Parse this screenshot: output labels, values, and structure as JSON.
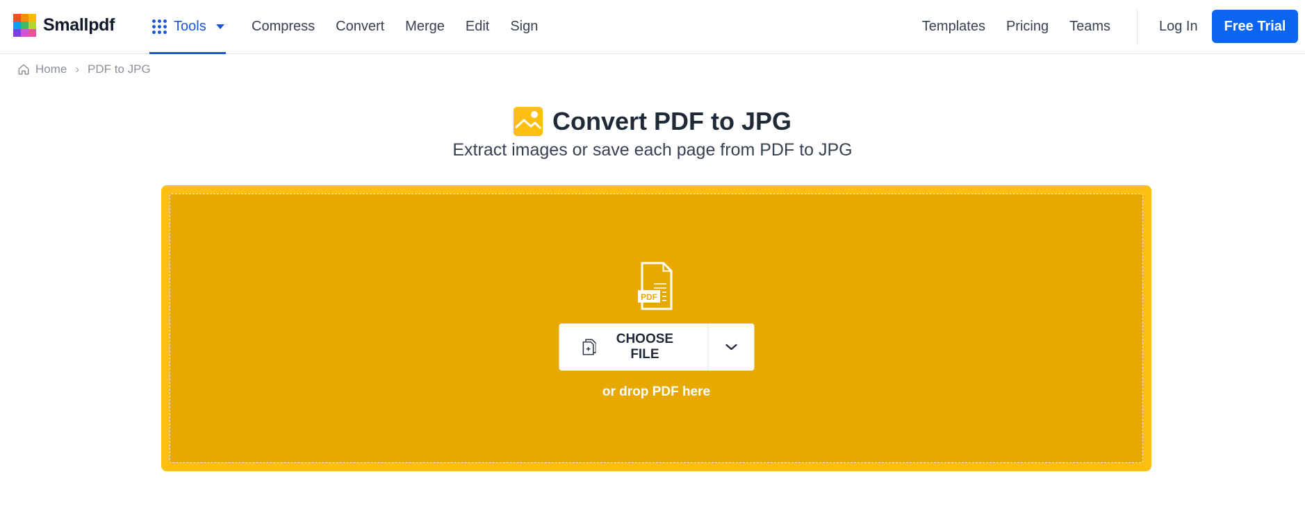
{
  "brand": {
    "name": "Smallpdf",
    "logo_colors": [
      "#f25022",
      "#ffb900",
      "#7fba00",
      "#00a4ef",
      "#3fba6b",
      "#b4d335",
      "#a05eb5",
      "#d94fd8",
      "#f050a0"
    ]
  },
  "nav": {
    "tools_label": "Tools",
    "left_links": [
      "Compress",
      "Convert",
      "Merge",
      "Edit",
      "Sign"
    ],
    "right_links": [
      "Templates",
      "Pricing",
      "Teams"
    ],
    "login_label": "Log In",
    "trial_label": "Free Trial"
  },
  "breadcrumb": {
    "home": "Home",
    "current": "PDF to JPG"
  },
  "hero": {
    "title": "Convert PDF to JPG",
    "subtitle": "Extract images or save each page from PDF to JPG"
  },
  "dropzone": {
    "file_badge": "PDF",
    "choose_label": "CHOOSE FILE",
    "drop_hint": "or drop PDF here",
    "accent_color": "#fcbe11"
  },
  "colors": {
    "primary": "#0b65f0",
    "tools_active": "#1a56db"
  }
}
